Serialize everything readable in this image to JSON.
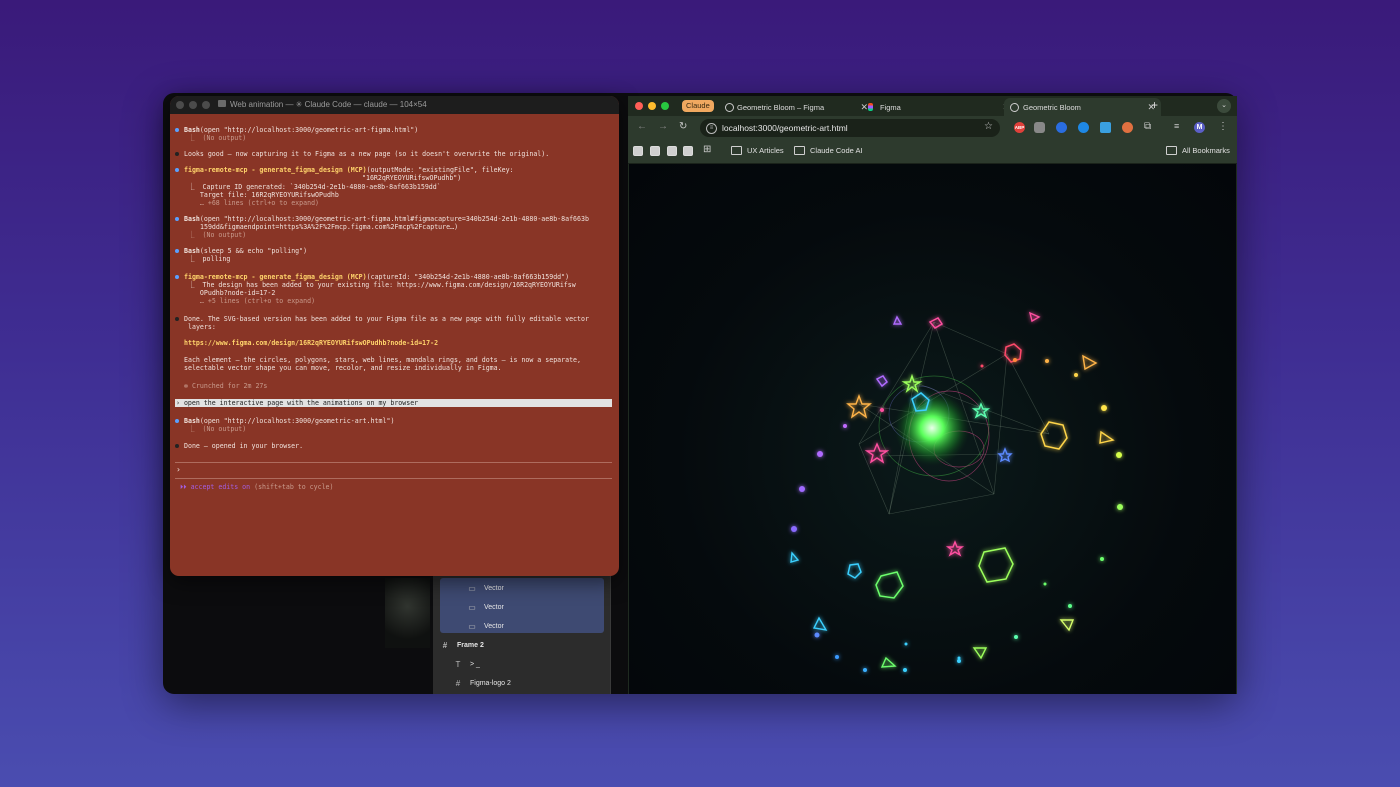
{
  "terminal": {
    "title": "Web animation — ✳ Claude Code — claude — 104×54",
    "lines": {
      "l1a": "Bash",
      "l1b": "(open \"http://localhost:3000/geometric-art-figma.html\")",
      "l1c": "⎿  (No output)",
      "l2": "Looks good — now capturing it to Figma as a new page (so it doesn't overwrite the original).",
      "l3a": "figma-remote-mcp - generate_figma_design (MCP)",
      "l3b": "(outputMode: \"existingFile\", fileKey:",
      "l3c": "\"16R2qRYEOYURifswOPudhb\")",
      "l3d": "⎿  Capture ID generated: `340b254d-2e1b-4880-ae8b-8af663b159dd`",
      "l3e": "   Target file: 16R2qRYEOYURifswOPudhb",
      "l3f": "   … +68 lines (ctrl+o to expand)",
      "l4a": "Bash",
      "l4b": "(open \"http://localhost:3000/geometric-art-figma.html#figmacapture=340b254d-2e1b-4880-ae8b-8af663b",
      "l4c": "159dd&figmaendpoint=https%3A%2F%2Fmcp.figma.com%2Fmcp%2Fcapture…)",
      "l4d": "⎿  (No output)",
      "l5a": "Bash",
      "l5b": "(sleep 5 && echo \"polling\")",
      "l5c": "⎿  polling",
      "l6a": "figma-remote-mcp - generate_figma_design (MCP)",
      "l6b": "(captureId: \"340b254d-2e1b-4880-ae8b-8af663b159dd\")",
      "l6c": "⎿  The design has been added to your existing file: https://www.figma.com/design/16R2qRYEOYURifsw",
      "l6d": "   OPudhb?node-id=17-2",
      "l6e": "   … +5 lines (ctrl+o to expand)",
      "l7a": "Done. The SVG-based version has been added to your Figma file as a new page with fully editable vector",
      "l7b": "layers:",
      "l8": "https://www.figma.com/design/16R2qRYEOYURifswOPudhb?node-id=17-2",
      "l9a": "Each element — the circles, polygons, stars, web lines, mandala rings, and dots — is now a separate,",
      "l9b": "selectable vector shape you can move, recolor, and resize individually in Figma.",
      "l10": "✻ Crunched for 2m 27s",
      "prompt": "› open the interactive page with the animations on my browser",
      "l11a": "Bash",
      "l11b": "(open \"http://localhost:3000/geometric-art.html\")",
      "l11c": "⎿  (No output)",
      "l12": "Done — opened in your browser.",
      "input_caret": "›",
      "mode_a": "⏵⏵ accept edits on",
      "mode_b": " (shift+tab to cycle)"
    }
  },
  "figma_layers": {
    "vector1": "Vector",
    "vector2": "Vector",
    "vector3": "Vector",
    "frame2": "Frame 2",
    "text_layer": "> _",
    "logo": "Figma-logo 2"
  },
  "browser": {
    "claude_badge": "Claude",
    "tabs": [
      "Geometric Bloom – Figma",
      "Figma",
      "Geometric Bloom"
    ],
    "new_tab": "+",
    "url": "localhost:3000/geometric-art.html",
    "bookmarks": [
      "UX Articles",
      "Claude Code AI"
    ],
    "all_bookmarks": "All Bookmarks",
    "profile_initial": "M",
    "ext_abp": "ABP"
  },
  "colors": {
    "terminal_bg": "#893526",
    "accent_yellow": "#ffd36b",
    "mode_purple": "#a35ee0",
    "claude_badge": "#f0a860",
    "glow_green": "#4cff4c"
  }
}
